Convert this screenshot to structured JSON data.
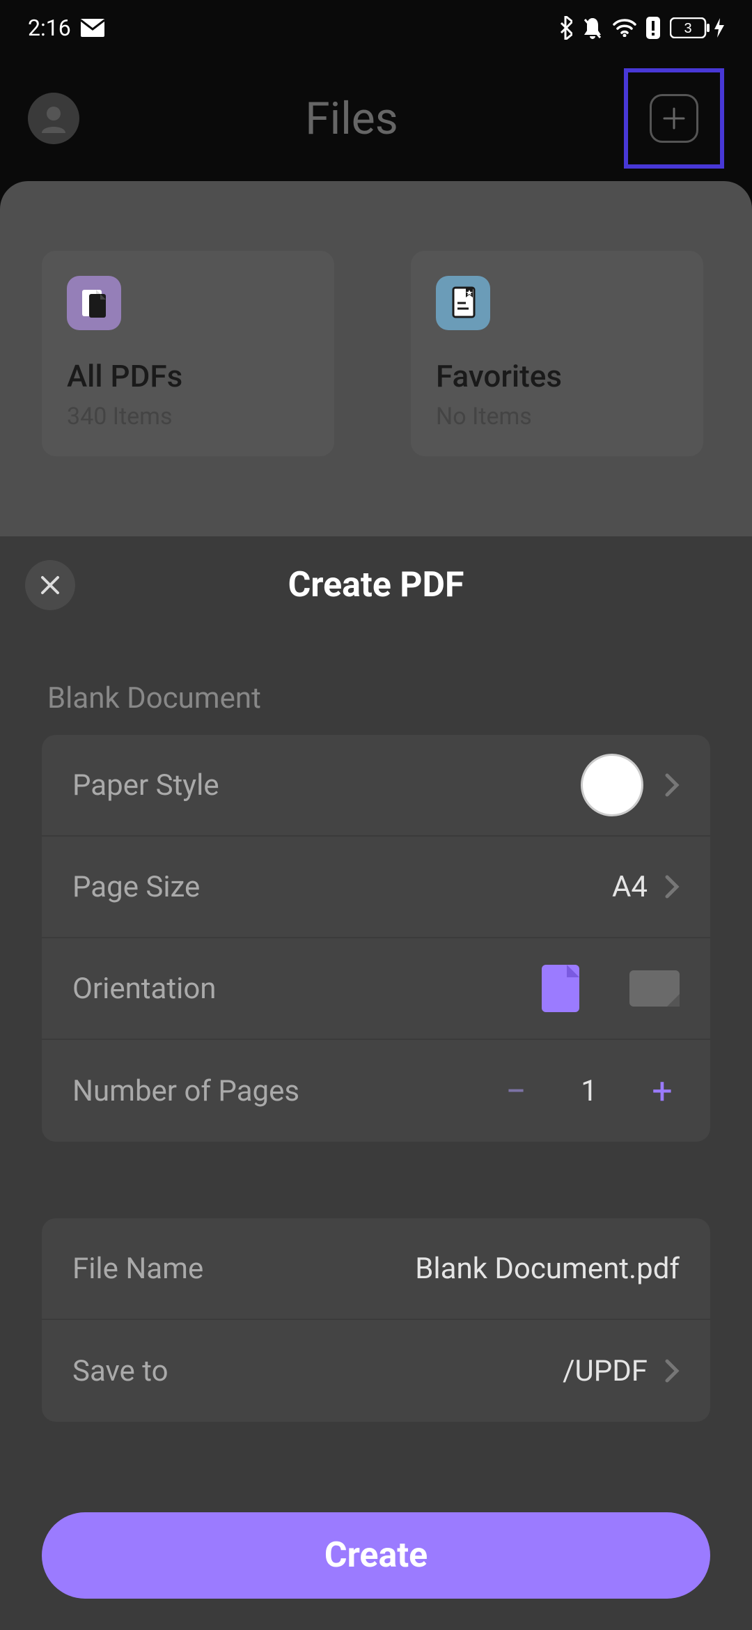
{
  "status": {
    "time": "2:16",
    "battery_count": "3"
  },
  "header": {
    "title": "Files"
  },
  "folders": [
    {
      "title": "All PDFs",
      "subtitle": "340 Items"
    },
    {
      "title": "Favorites",
      "subtitle": "No Items"
    }
  ],
  "sheet": {
    "title": "Create PDF",
    "section_label": "Blank Document",
    "rows": {
      "paper_style": {
        "label": "Paper Style"
      },
      "page_size": {
        "label": "Page Size",
        "value": "A4"
      },
      "orientation": {
        "label": "Orientation"
      },
      "num_pages": {
        "label": "Number of Pages",
        "value": "1"
      },
      "file_name": {
        "label": "File Name",
        "value": "Blank Document.pdf"
      },
      "save_to": {
        "label": "Save to",
        "value": "/UPDF"
      }
    },
    "create_label": "Create"
  }
}
